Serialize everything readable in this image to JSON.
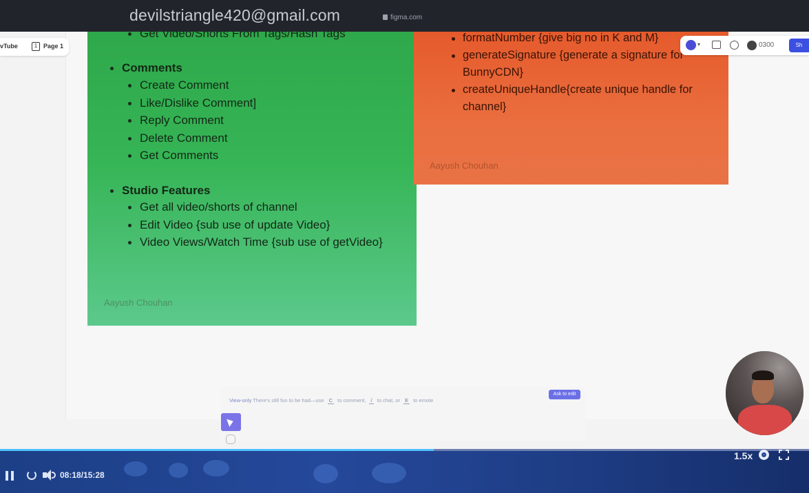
{
  "browser": {
    "account_email": "devilstriangle420@gmail.com",
    "domain": "figma.com"
  },
  "figma": {
    "file_tab": "vTube",
    "page_tab": "Page 1",
    "zoom": "0300",
    "share_label": "Sh"
  },
  "green_note": {
    "top_item": "Get Video/Shorts From Tags/Hash Tags",
    "sections": [
      {
        "heading": "Comments",
        "items": [
          "Create Comment",
          "Like/Dislike Comment]",
          "Reply Comment",
          "Delete Comment",
          "Get Comments"
        ]
      },
      {
        "heading": "Studio Features",
        "items": [
          "Get all video/shorts of channel",
          "Edit Video  {sub use of update Video}",
          "Video Views/Watch Time {sub use of getVideo}"
        ]
      }
    ],
    "author": "Aayush Chouhan"
  },
  "orange_note": {
    "items": [
      "formatNumber {give big no in K and M}",
      "generateSignature {generate a signature for BunnyCDN}",
      "createUniqueHandle{create unique handle for channel}"
    ],
    "author": "Aayush Chouhan"
  },
  "view_only_bar": {
    "mode": "View-only",
    "message_prefix": "There's still fun to be had—use",
    "key_comment": "C",
    "message_comment": "to comment,",
    "key_chat": "/",
    "message_chat": "to chat, or",
    "key_emote": "E",
    "message_emote": "to emote",
    "ask_button": "Ask to edit"
  },
  "player": {
    "time": "08:18/15:28",
    "speed": "1.5x",
    "progress": 0.536
  },
  "colors": {
    "green_note": "#36b556",
    "orange_note": "#ea6e3f",
    "player_bar": "#25489a",
    "progress": "#4fc1ff"
  }
}
